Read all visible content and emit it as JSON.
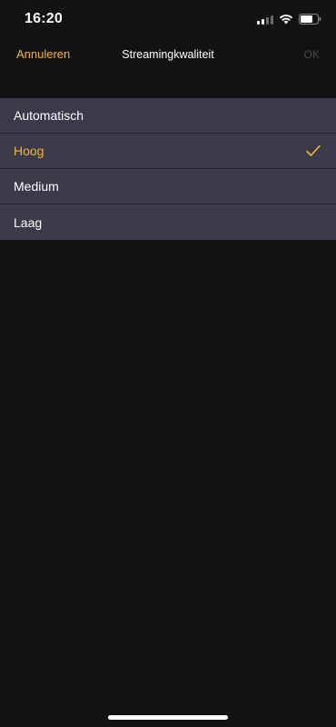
{
  "status_bar": {
    "time": "16:20",
    "icons": [
      "signal-icon",
      "wifi-icon",
      "battery-icon"
    ]
  },
  "nav": {
    "cancel_label": "Annuleren",
    "title": "Streamingkwaliteit",
    "ok_label": "OK"
  },
  "options": [
    {
      "label": "Automatisch",
      "selected": false
    },
    {
      "label": "Hoog",
      "selected": true
    },
    {
      "label": "Medium",
      "selected": false
    },
    {
      "label": "Laag",
      "selected": false
    }
  ],
  "colors": {
    "accent": "#f3b731",
    "background": "#121212",
    "row_background": "#3a3a4a",
    "disabled_text": "#4a4a4a"
  }
}
